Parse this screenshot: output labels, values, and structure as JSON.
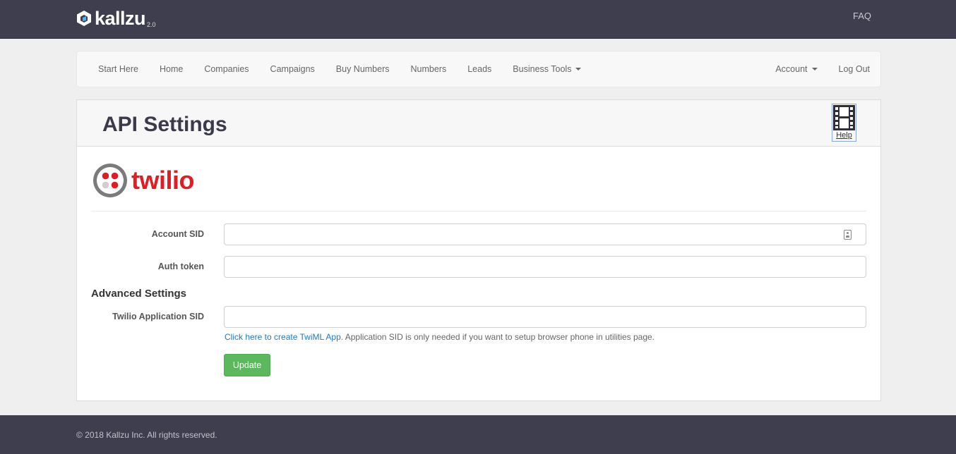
{
  "header": {
    "brand": "kallzu",
    "version": "2.0",
    "faq": "FAQ"
  },
  "nav": {
    "left": [
      {
        "label": "Start Here"
      },
      {
        "label": "Home"
      },
      {
        "label": "Companies"
      },
      {
        "label": "Campaigns"
      },
      {
        "label": "Buy Numbers"
      },
      {
        "label": "Numbers"
      },
      {
        "label": "Leads"
      },
      {
        "label": "Business Tools"
      }
    ],
    "right": [
      {
        "label": "Account"
      },
      {
        "label": "Log Out"
      }
    ]
  },
  "panel": {
    "title": "API Settings",
    "help_label": "Help",
    "provider_logo": "twilio",
    "fields": {
      "account_sid": {
        "label": "Account SID",
        "value": ""
      },
      "auth_token": {
        "label": "Auth token",
        "value": ""
      },
      "app_sid": {
        "label": "Twilio Application SID",
        "value": ""
      }
    },
    "advanced_heading": "Advanced Settings",
    "help_link": "Click here to create TwiML App",
    "help_text": ". Application SID is only needed if you want to setup browser phone in utilities page.",
    "update_label": "Update"
  },
  "footer": {
    "text": "© 2018 Kallzu Inc. All rights reserved."
  },
  "colors": {
    "topbar": "#3f3e4e",
    "twilio_red": "#e11c23",
    "button_green": "#5cb85c",
    "link_blue": "#1f7bc3"
  },
  "icons": {
    "brand": "hexagon-logo-icon",
    "help": "film-strip-icon",
    "field_badge": "contact-card-icon"
  }
}
